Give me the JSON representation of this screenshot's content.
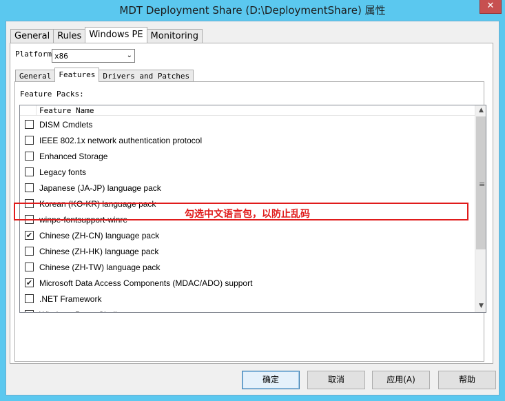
{
  "window": {
    "title": "MDT Deployment Share (D:\\DeploymentShare) 属性",
    "close_glyph": "✕"
  },
  "outer_tabs": [
    "General",
    "Rules",
    "Windows PE",
    "Monitoring"
  ],
  "platform": {
    "label": "Platform:",
    "value": "x86"
  },
  "inner_tabs": [
    "General",
    "Features",
    "Drivers and Patches"
  ],
  "feature_packs_label": "Feature Packs:",
  "list": {
    "column_header": "Feature Name",
    "items": [
      {
        "name": "DISM Cmdlets",
        "checked": false
      },
      {
        "name": "IEEE 802.1x network authentication protocol",
        "checked": false
      },
      {
        "name": "Enhanced Storage",
        "checked": false
      },
      {
        "name": "Legacy fonts",
        "checked": false
      },
      {
        "name": "Japanese (JA-JP) language pack",
        "checked": false
      },
      {
        "name": "Korean (KO-KR) language pack",
        "checked": false
      },
      {
        "name": "winpe-fontsupport-winre",
        "checked": false
      },
      {
        "name": "Chinese (ZH-CN) language pack",
        "checked": true
      },
      {
        "name": "Chinese (ZH-HK) language pack",
        "checked": false
      },
      {
        "name": "Chinese (ZH-TW) language pack",
        "checked": false
      },
      {
        "name": "Microsoft Data Access Components (MDAC/ADO) support",
        "checked": true
      },
      {
        "name": ".NET Framework",
        "checked": false
      },
      {
        "name": "Windows PowerShell",
        "checked": false
      }
    ]
  },
  "annotation": "勾选中文语言包，以防止乱码",
  "buttons": {
    "ok": "确定",
    "cancel": "取消",
    "apply": "应用(A)",
    "help": "帮助"
  },
  "colors": {
    "titlebar": "#5bc8ef",
    "highlight": "#e01b1b"
  }
}
